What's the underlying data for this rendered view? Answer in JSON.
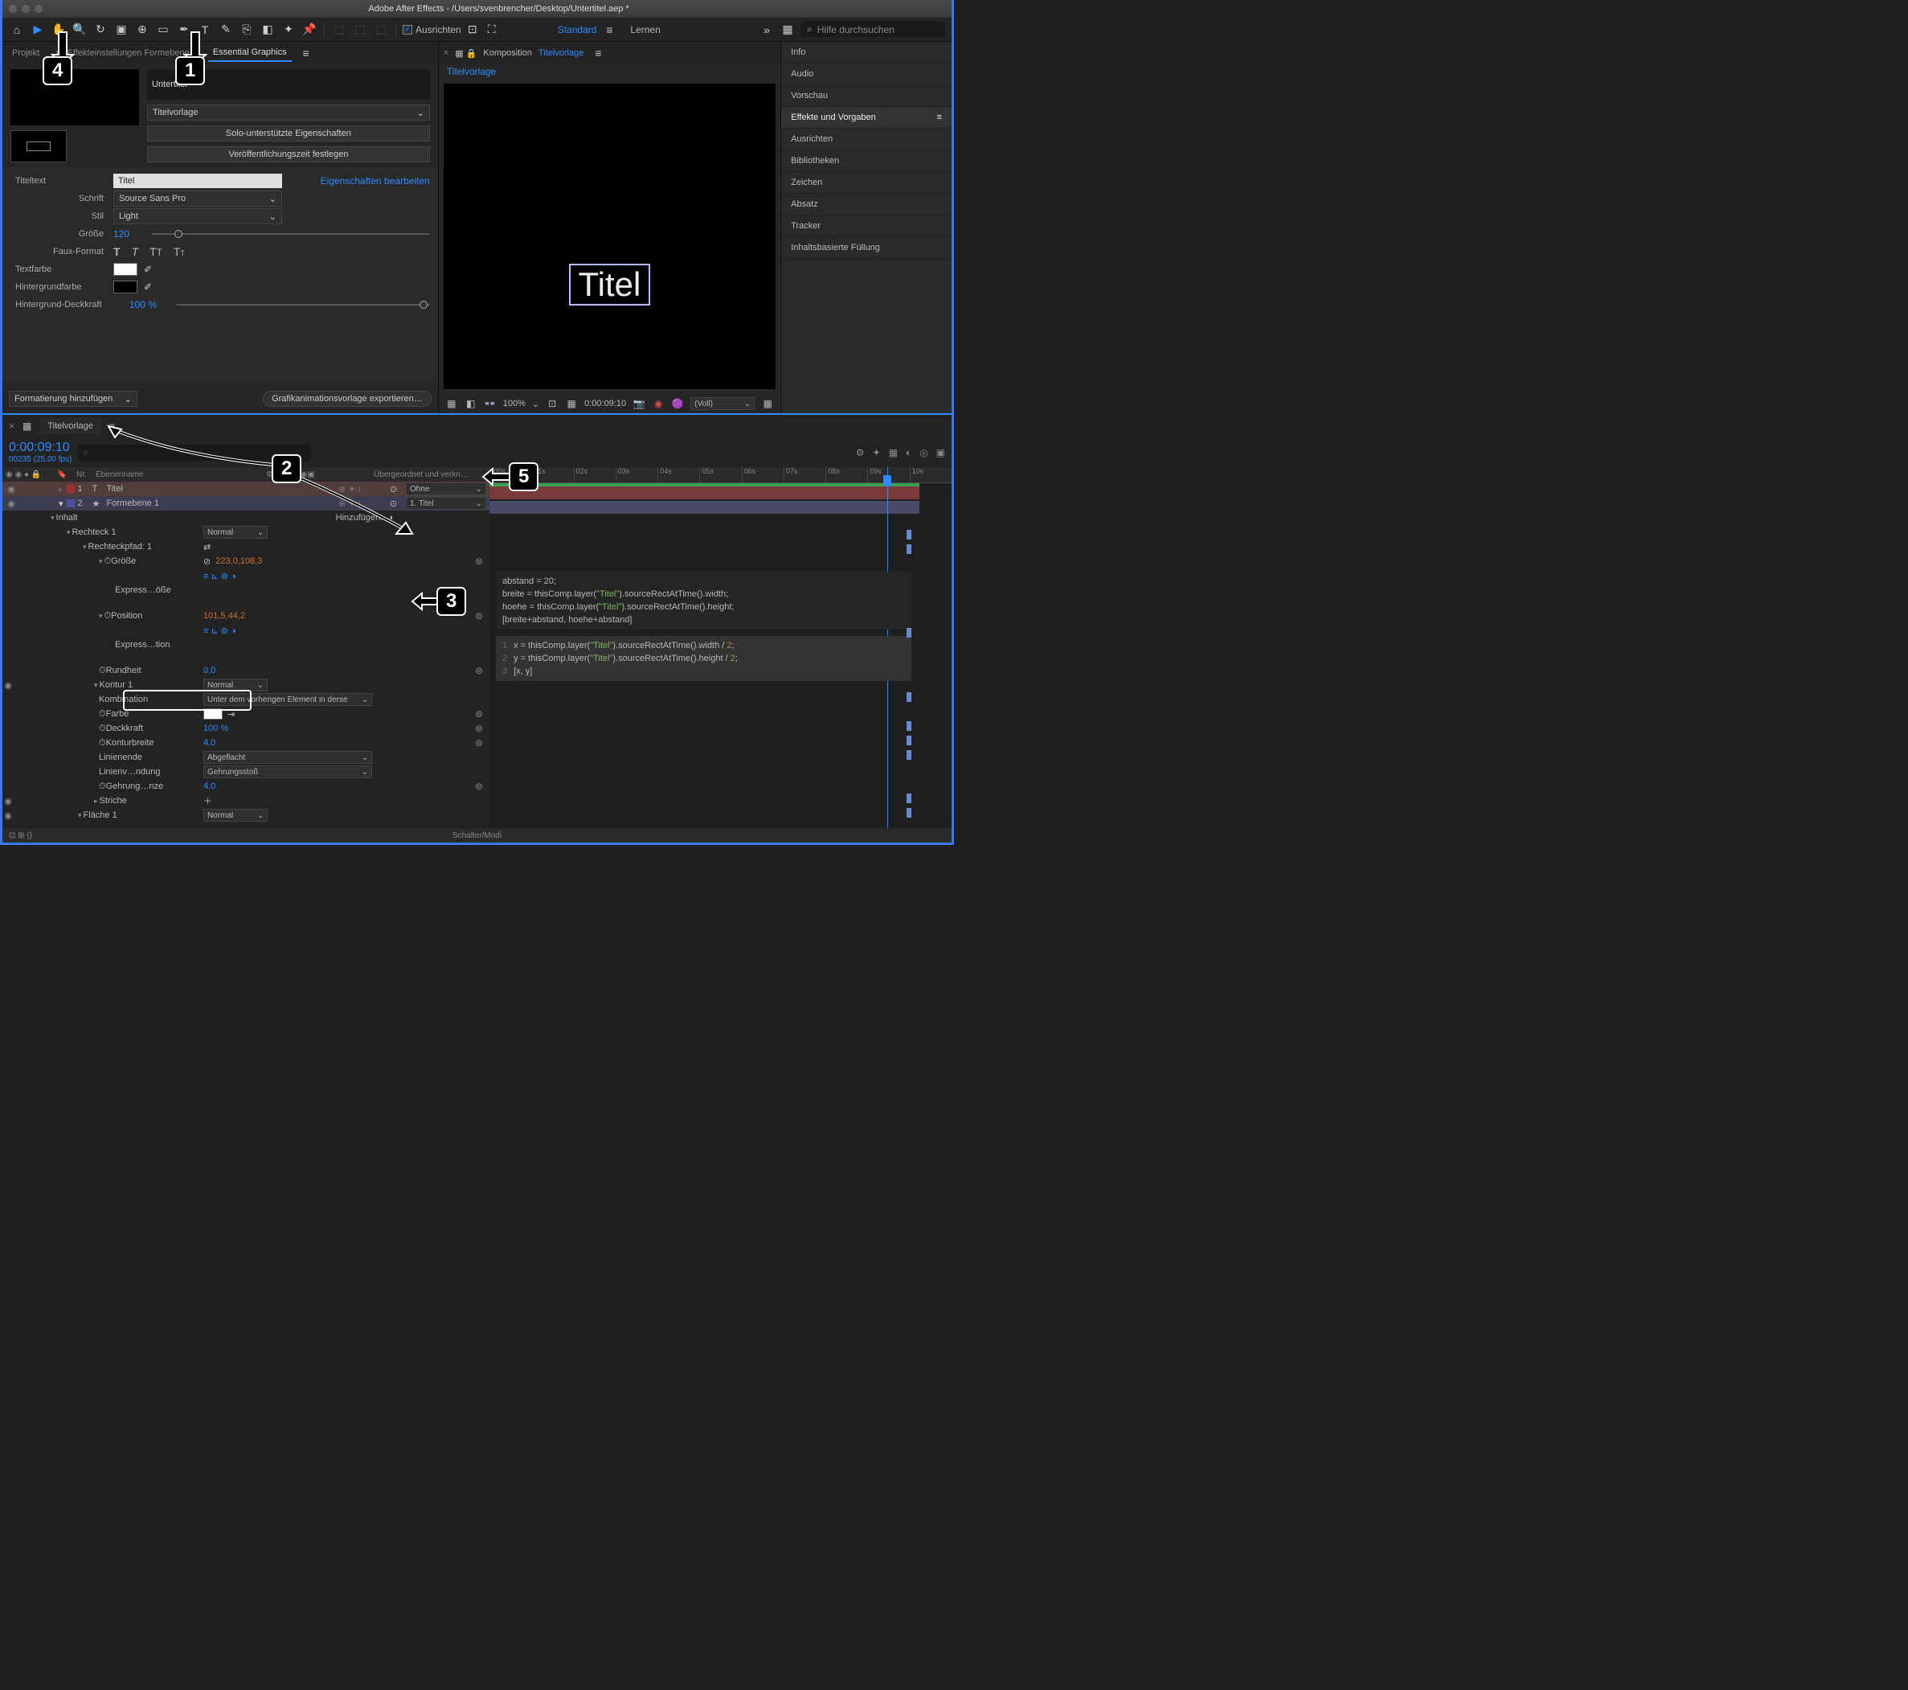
{
  "window_title": "Adobe After Effects - /Users/svenbrencher/Desktop/Untertitel.aep *",
  "toolbar": {
    "align_label": "Ausrichten",
    "workspace1": "Standard",
    "workspace2": "Lernen",
    "search_placeholder": "Hilfe durchsuchen"
  },
  "left_tabs": {
    "project": "Projekt",
    "effects": "Effekteinstellungen Formebene 1",
    "egp": "Essential Graphics"
  },
  "egp": {
    "name_value": "Untertitel",
    "master_value": "Titelvorlage",
    "btn_solo": "Solo-unterstützte Eigenschaften",
    "btn_pubtime": "Veröffentlichungszeit festlegen",
    "prop_titeltext": "Titeltext",
    "titeltext_value": "Titel",
    "edit_props": "Eigenschaften bearbeiten",
    "prop_schrift": "Schrift",
    "schrift_value": "Source Sans Pro",
    "prop_stil": "Stil",
    "stil_value": "Light",
    "prop_groesse": "Größe",
    "groesse_value": "120",
    "prop_faux": "Faux-Format",
    "prop_textfarbe": "Textfarbe",
    "prop_bg": "Hintergrundfarbe",
    "prop_bgop": "Hintergrund-Deckkraft",
    "bgop_value": "100 %",
    "add_format": "Formatierung hinzufügen",
    "export_btn": "Grafikanimationsvorlage exportieren…"
  },
  "comp": {
    "header_prefix": "Komposition",
    "header_name": "Titelvorlage",
    "breadcrumb": "Titelvorlage",
    "title_text": "Titel",
    "zoom": "100%",
    "timecode": "0:00:09:10",
    "res": "(Voll)"
  },
  "right_panels": [
    "Info",
    "Audio",
    "Vorschau",
    "Effekte und Vorgaben",
    "Ausrichten",
    "Bibliotheken",
    "Zeichen",
    "Absatz",
    "Tracker",
    "Inhaltsbasierte Füllung"
  ],
  "timeline": {
    "tab": "Titelvorlage",
    "timecode": "0:00:09:10",
    "frames": "00235 (25.00 fps)",
    "col_nr": "Nr.",
    "col_name": "Ebenenname",
    "col_parent": "Übergeordnet und verkn…",
    "layer1_nr": "1",
    "layer1_name": "Titel",
    "layer1_parent": "Ohne",
    "layer2_nr": "2",
    "layer2_name": "Formebene 1",
    "layer2_parent": "1. Titel",
    "inhalt": "Inhalt",
    "hinzu": "Hinzufügen:",
    "rechteck": "Rechteck 1",
    "rechteck_mode": "Normal",
    "rechteckpfad": "Rechteckpfad: 1",
    "groesse": "Größe",
    "groesse_val": "223,0,108,3",
    "expr_groesse": "Express…öße",
    "position": "Position",
    "position_val": "101,5,44,2",
    "expr_position": "Express…tion",
    "rundheit": "Rundheit",
    "rundheit_val": "0,0",
    "kontur": "Kontur 1",
    "kontur_mode": "Normal",
    "kombination": "Kombination",
    "kombination_val": "Unter dem vorherigen Element in derse",
    "farbe": "Farbe",
    "deckkraft": "Deckkraft",
    "deckkraft_val": "100 %",
    "konturbreite": "Konturbreite",
    "konturbreite_val": "4,0",
    "linienende": "Linienende",
    "linienende_val": "Abgeflacht",
    "linienv": "Linienv…ndung",
    "linienv_val": "Gehrungsstoß",
    "gehrung": "Gehrung…nze",
    "gehrung_val": "4,0",
    "striche": "Striche",
    "flaeche": "Fläche 1",
    "flaeche_mode": "Normal",
    "footer": "Schalter/Modi"
  },
  "ruler": [
    ":00s",
    "01s",
    "02s",
    "03s",
    "04s",
    "05s",
    "06s",
    "07s",
    "08s",
    "09s",
    "10s"
  ],
  "expr1_l1": "abstand = 20;",
  "expr1_l2a": "breite = thisComp.layer(",
  "expr1_l2b": ").sourceRectAtTime().width;",
  "expr1_l3a": "hoehe = thisComp.layer(",
  "expr1_l3b": ").sourceRectAtTime().height;",
  "expr1_l4": "[breite+abstand, hoehe+abstand]",
  "expr2_l1a": "x = thisComp.layer(",
  "expr2_l1b": ").sourceRectAtTime().width / ",
  "expr2_l1c": ";",
  "expr2_l2a": "y = thisComp.layer(",
  "expr2_l2b": ").sourceRectAtTime().height / ",
  "expr2_l2c": ";",
  "expr2_l3": "[x, y]",
  "str_titel": "\"Titel\"",
  "num_2": "2",
  "ann": {
    "1": "1",
    "2": "2",
    "3": "3",
    "4": "4",
    "5": "5"
  }
}
